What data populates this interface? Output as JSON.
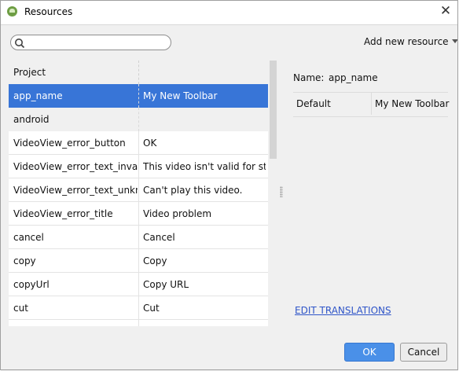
{
  "window": {
    "title": "Resources",
    "close_glyph": "✕"
  },
  "toolbar": {
    "search_placeholder": "",
    "add_new_label": "Add new resource"
  },
  "table": {
    "rows": [
      {
        "kind": "header",
        "name": "Project",
        "value": ""
      },
      {
        "kind": "selected",
        "name": "app_name",
        "value": "My New Toolbar"
      },
      {
        "kind": "group",
        "name": "android",
        "value": ""
      },
      {
        "kind": "data",
        "name": "VideoView_error_button",
        "value": "OK"
      },
      {
        "kind": "data",
        "name": "VideoView_error_text_invalid_p",
        "value": "This video isn't valid for str..."
      },
      {
        "kind": "data",
        "name": "VideoView_error_text_unknown",
        "value": "Can't play this video."
      },
      {
        "kind": "data",
        "name": "VideoView_error_title",
        "value": "Video problem"
      },
      {
        "kind": "data",
        "name": "cancel",
        "value": "Cancel"
      },
      {
        "kind": "data",
        "name": "copy",
        "value": "Copy"
      },
      {
        "kind": "data",
        "name": "copyUrl",
        "value": "Copy URL"
      },
      {
        "kind": "data",
        "name": "cut",
        "value": "Cut"
      },
      {
        "kind": "data",
        "name": "",
        "value": ""
      }
    ]
  },
  "details": {
    "name_label": "Name:",
    "name_value": "app_name",
    "translations": [
      {
        "locale": "Default",
        "value": "My New Toolbar"
      }
    ],
    "edit_link": "EDIT TRANSLATIONS"
  },
  "buttons": {
    "ok": "OK",
    "cancel": "Cancel"
  },
  "colors": {
    "selection": "#3875d7",
    "ok_button": "#4a90e8",
    "link": "#2f55c8",
    "app_icon": "#6e9e44"
  }
}
